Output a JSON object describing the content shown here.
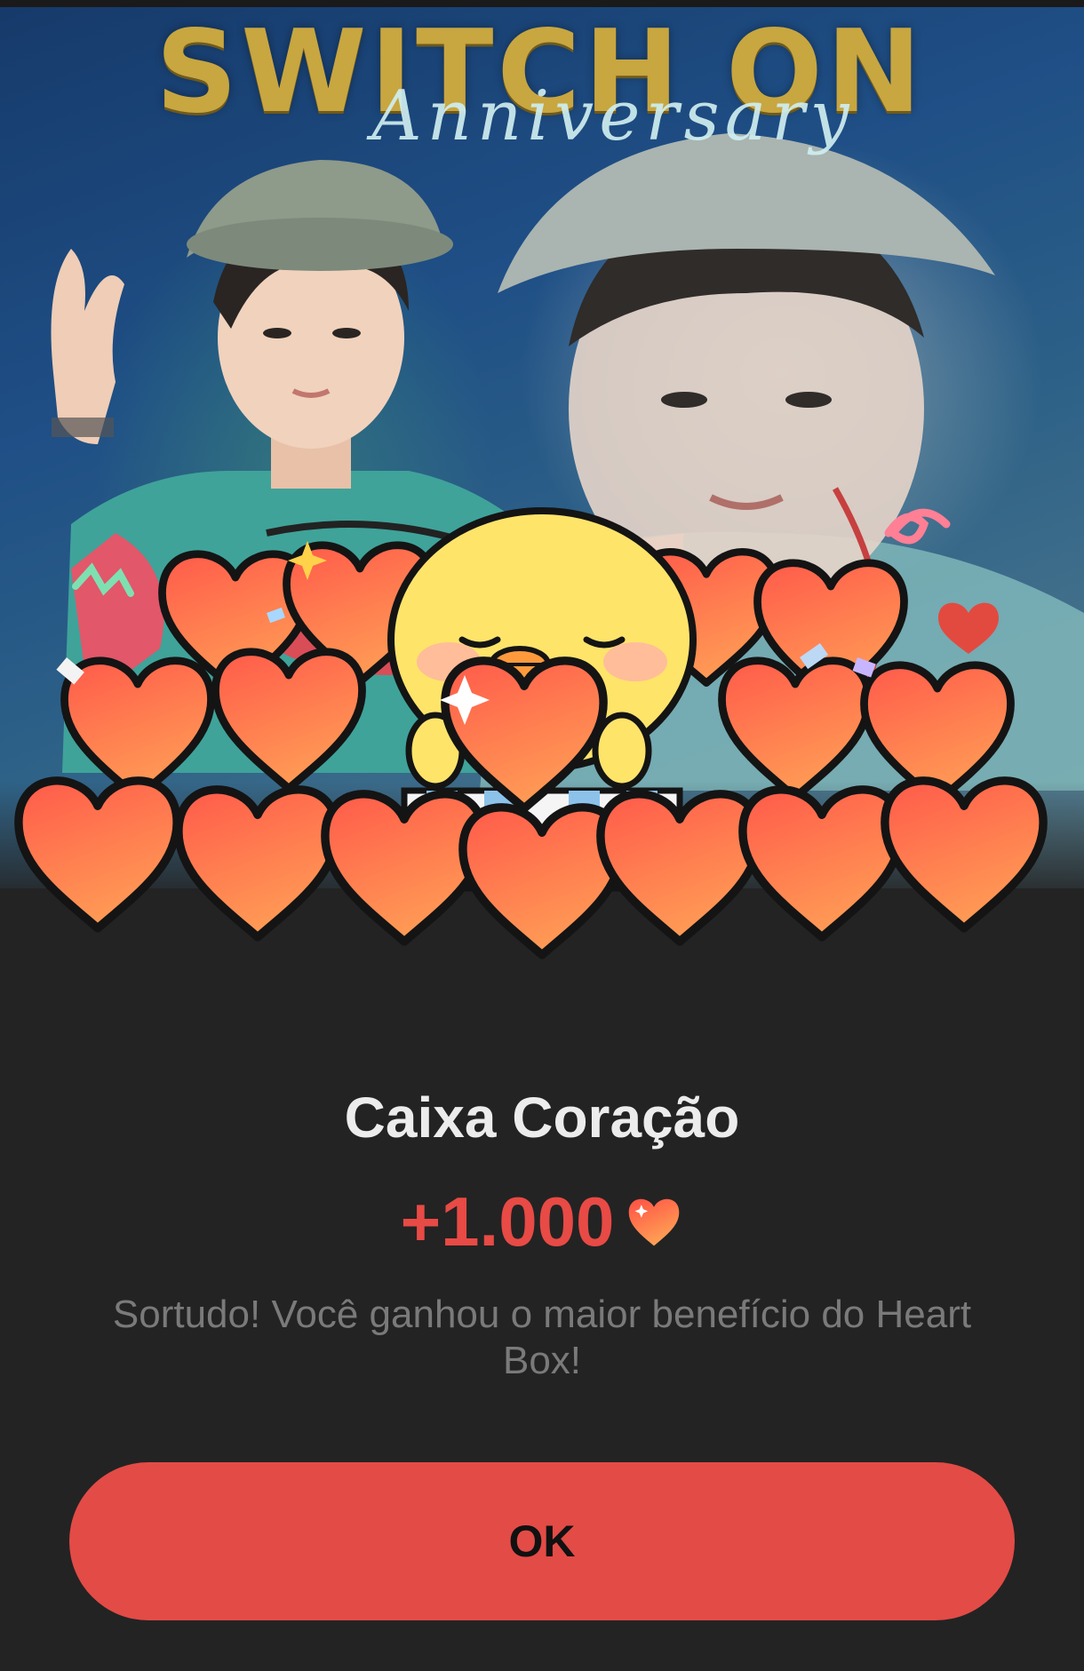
{
  "banner": {
    "title": "SWITCH ON",
    "subtitle": "Anniversary"
  },
  "dialog": {
    "title": "Caixa Coração",
    "amount": "+1.000",
    "amount_icon": "heart-icon",
    "message": "Sortudo! Você ganhou o maior benefício do Heart Box!",
    "ok_label": "OK"
  },
  "colors": {
    "accent": "#e34b46",
    "amount_text": "#e84a45",
    "dialog_background": "#232323",
    "title_text": "#ececec",
    "message_text": "#7a7a7a",
    "banner_title": "#c8a640"
  }
}
